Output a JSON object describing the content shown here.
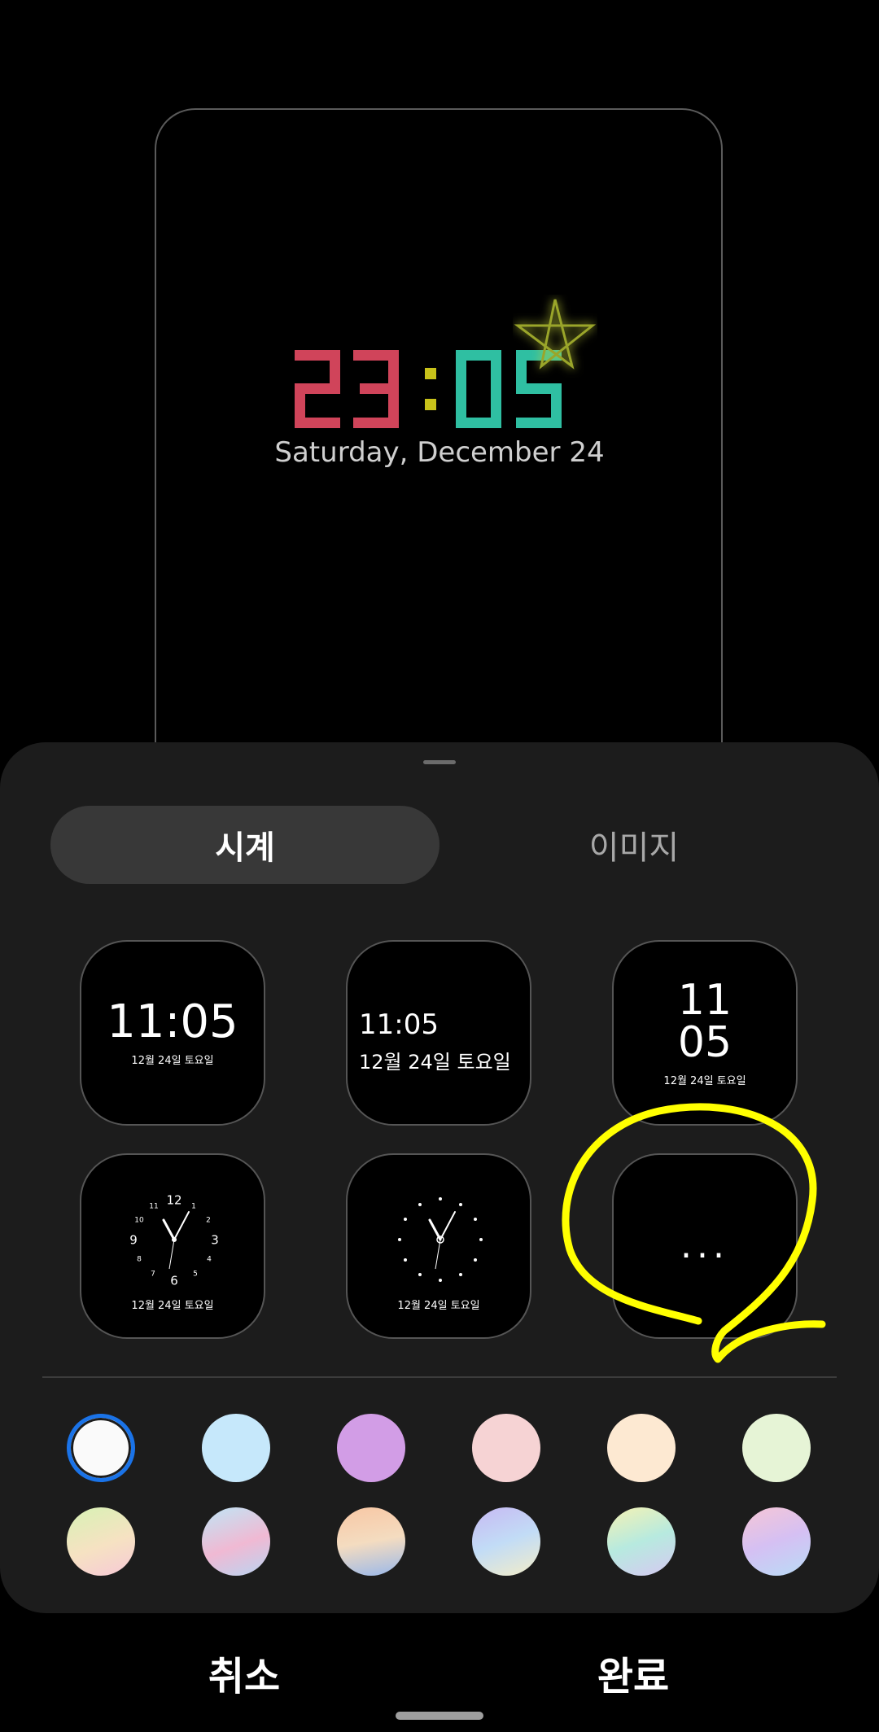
{
  "preview": {
    "clock_digits": "23:05",
    "date": "Saturday, December 24",
    "colors": {
      "hours": "#d0445a",
      "colon": "#c8c21a",
      "minutes": "#2fbfa2",
      "star": "#9aa52a"
    }
  },
  "tabs": [
    {
      "label": "시계",
      "active": true
    },
    {
      "label": "이미지",
      "active": false
    }
  ],
  "clock_styles": [
    {
      "time": "11:05",
      "date": "12월 24일 토요일"
    },
    {
      "time": "11:05",
      "date": "12월 24일 토요일"
    },
    {
      "time_hour": "11",
      "time_min": "05",
      "date": "12월 24일 토요일"
    },
    {
      "numerals": [
        "12",
        "1",
        "2",
        "3",
        "4",
        "5",
        "6",
        "7",
        "8",
        "9",
        "10",
        "11"
      ],
      "date": "12월 24일 토요일"
    },
    {
      "date": "12월 24일 토요일"
    },
    {
      "more_icon": "more-horizontal-icon",
      "label": "..."
    }
  ],
  "color_swatches": [
    "#fafafa",
    "#c6e8fb",
    "#d29de6",
    "#f6d3d4",
    "#fde9d2",
    "#e6f4d6",
    "gradient-1",
    "gradient-2",
    "gradient-3",
    "gradient-4",
    "gradient-5",
    "gradient-6"
  ],
  "selected_swatch": 0,
  "actions": {
    "cancel": "취소",
    "done": "완료"
  },
  "annotation_color": "#ffff00"
}
